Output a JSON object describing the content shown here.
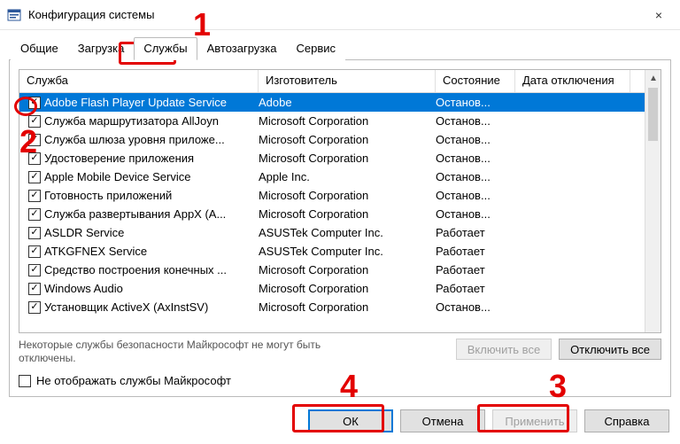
{
  "window": {
    "title": "Конфигурация системы",
    "close_icon": "×"
  },
  "tabs": {
    "general": "Общие",
    "boot": "Загрузка",
    "services": "Службы",
    "startup": "Автозагрузка",
    "tools": "Сервис"
  },
  "columns": {
    "service": "Служба",
    "manufacturer": "Изготовитель",
    "state": "Состояние",
    "date_disabled": "Дата отключения"
  },
  "rows": [
    {
      "name": "Adobe Flash Player Update Service",
      "mfg": "Adobe",
      "state": "Останов...",
      "selected": true
    },
    {
      "name": "Служба маршрутизатора AllJoyn",
      "mfg": "Microsoft Corporation",
      "state": "Останов..."
    },
    {
      "name": "Служба шлюза уровня приложе...",
      "mfg": "Microsoft Corporation",
      "state": "Останов..."
    },
    {
      "name": "Удостоверение приложения",
      "mfg": "Microsoft Corporation",
      "state": "Останов..."
    },
    {
      "name": "Apple Mobile Device Service",
      "mfg": "Apple Inc.",
      "state": "Останов..."
    },
    {
      "name": "Готовность приложений",
      "mfg": "Microsoft Corporation",
      "state": "Останов..."
    },
    {
      "name": "Служба развертывания AppX (A...",
      "mfg": "Microsoft Corporation",
      "state": "Останов..."
    },
    {
      "name": "ASLDR Service",
      "mfg": "ASUSTek Computer Inc.",
      "state": "Работает"
    },
    {
      "name": "ATKGFNEX Service",
      "mfg": "ASUSTek Computer Inc.",
      "state": "Работает"
    },
    {
      "name": "Средство построения конечных ...",
      "mfg": "Microsoft Corporation",
      "state": "Работает"
    },
    {
      "name": "Windows Audio",
      "mfg": "Microsoft Corporation",
      "state": "Работает"
    },
    {
      "name": "Установщик ActiveX (AxInstSV)",
      "mfg": "Microsoft Corporation",
      "state": "Останов..."
    }
  ],
  "note": "Некоторые службы безопасности Майкрософт не могут быть отключены.",
  "buttons": {
    "enable_all": "Включить все",
    "disable_all": "Отключить все",
    "hide_ms": "Не отображать службы Майкрософт",
    "ok": "ОК",
    "cancel": "Отмена",
    "apply": "Применить",
    "help": "Справка"
  },
  "annotations": {
    "n1": "1",
    "n2": "2",
    "n3": "3",
    "n4": "4"
  },
  "checkmark": "✓",
  "scroll_up": "▲"
}
